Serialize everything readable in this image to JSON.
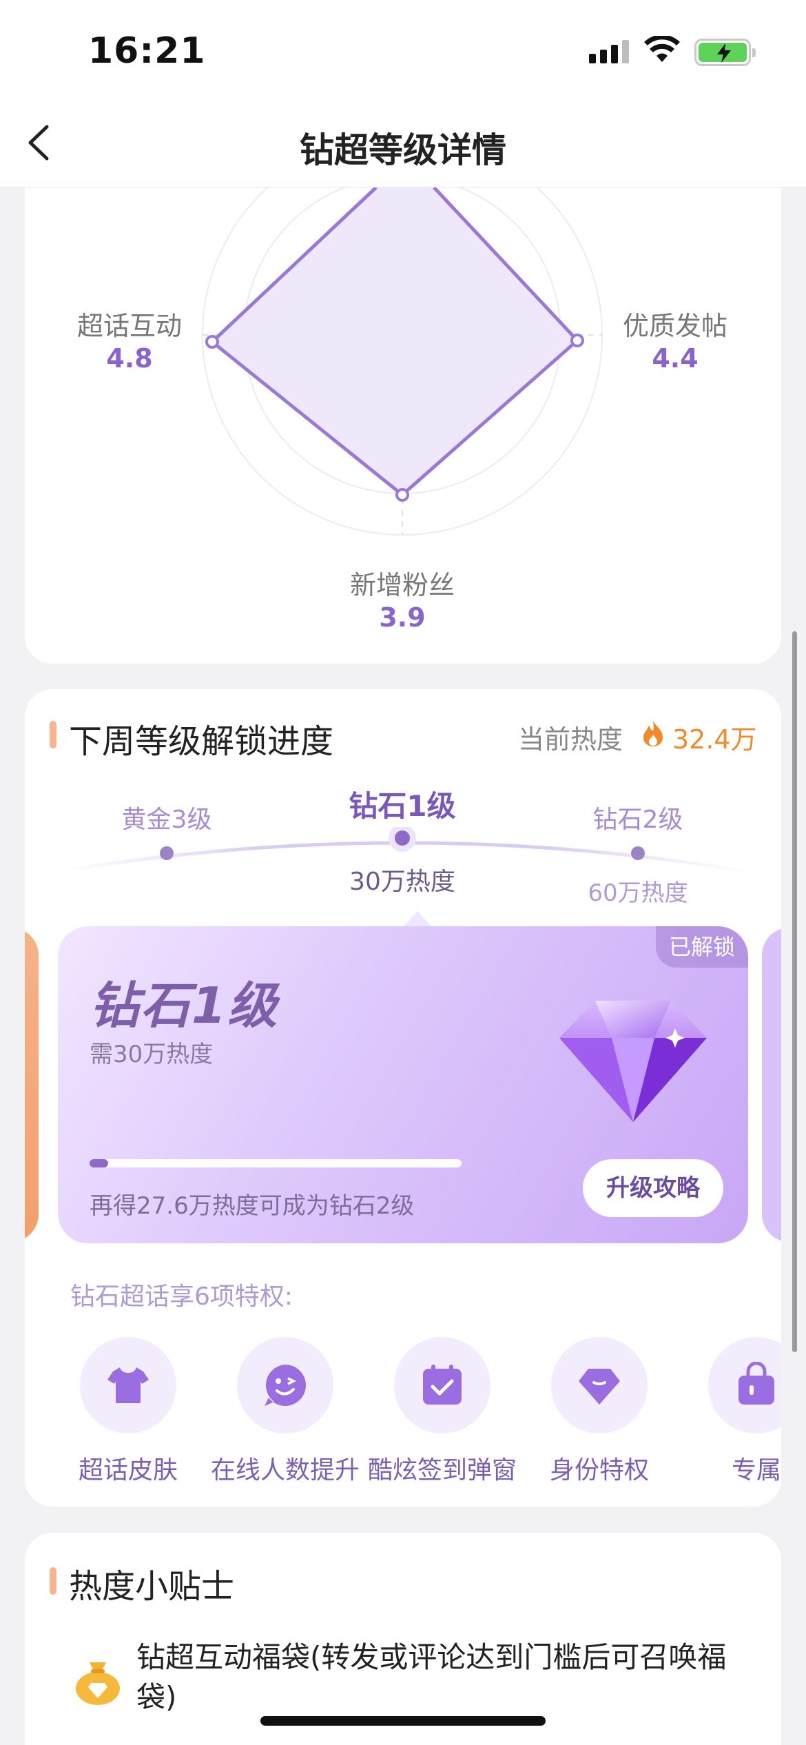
{
  "status_bar": {
    "time": "16:21"
  },
  "nav": {
    "title": "钻超等级详情"
  },
  "radar": {
    "axes": [
      {
        "label": "超话互动",
        "value": "4.8"
      },
      {
        "label": "优质发帖",
        "value": "4.4"
      },
      {
        "label": "新增粉丝",
        "value": "3.9"
      }
    ]
  },
  "unlock": {
    "title": "下周等级解锁进度",
    "heat_label": "当前热度",
    "heat_value": "32.4万",
    "levels": [
      {
        "name": "黄金3级",
        "heat": ""
      },
      {
        "name": "钻石1级",
        "heat": "30万热度"
      },
      {
        "name": "钻石2级",
        "heat": "60万热度"
      }
    ],
    "card": {
      "badge": "已解锁",
      "title": "钻石1级",
      "need": "需30万热度",
      "progress": 0.05,
      "hint": "再得27.6万热度可成为钻石2级",
      "button": "升级攻略"
    },
    "privilege_title": "钻石超话享6项特权:",
    "privileges": [
      {
        "label": "超话皮肤",
        "icon": "shirt-icon"
      },
      {
        "label": "在线人数提升",
        "icon": "smile-chat-icon"
      },
      {
        "label": "酷炫签到弹窗",
        "icon": "calendar-check-icon"
      },
      {
        "label": "身份特权",
        "icon": "diamond-icon"
      },
      {
        "label": "专属",
        "icon": "bag-icon"
      }
    ]
  },
  "tips": {
    "title": "热度小贴士",
    "items": [
      {
        "text": "钻超互动福袋(转发或评论达到门槛后可召唤福袋)",
        "icon": "lucky-bag-icon"
      }
    ]
  },
  "colors": {
    "accent_purple": "#8a64c8",
    "accent_orange": "#f08a2a",
    "section_marker": "#f6b58e"
  }
}
